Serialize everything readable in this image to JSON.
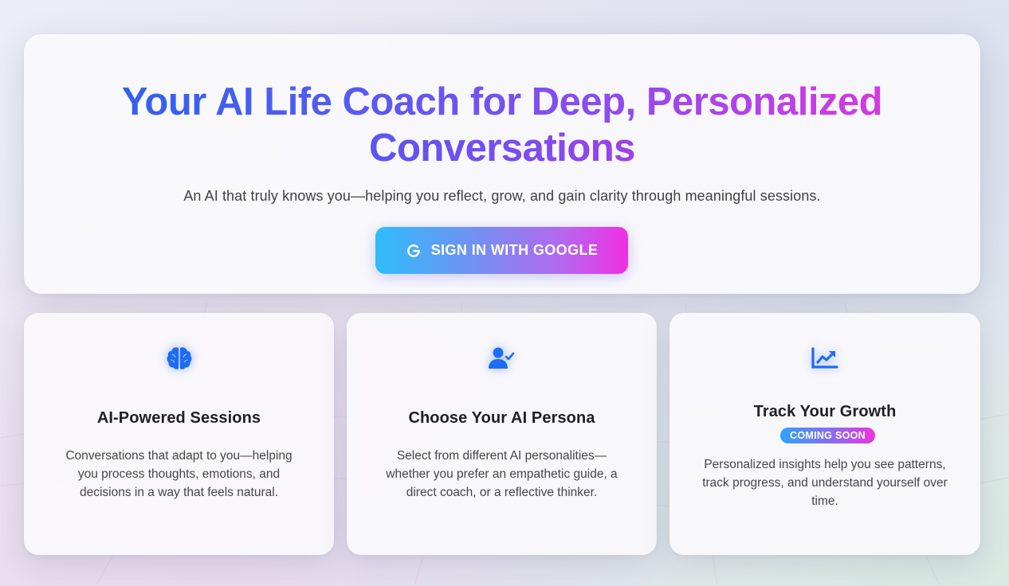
{
  "hero": {
    "title_line1": "Your AI Life Coach for Deep, Personalized",
    "title_line2": "Conversations",
    "subtitle": "An AI that truly knows you—helping you reflect, grow, and gain clarity through meaningful sessions.",
    "signin_label": "SIGN IN WITH GOOGLE",
    "signin_icon": "google-icon"
  },
  "features": [
    {
      "icon": "brain-icon",
      "title": "AI-Powered Sessions",
      "description": "Conversations that adapt to you—helping you process thoughts, emotions, and decisions in a way that feels natural."
    },
    {
      "icon": "user-check-icon",
      "title": "Choose Your AI Persona",
      "description": "Select from different AI personalities—whether you prefer an empathetic guide, a direct coach, or a reflective thinker."
    },
    {
      "icon": "chart-line-icon",
      "title": "Track Your Growth",
      "badge": "COMING SOON",
      "description": "Personalized insights help you see patterns, track progress, and understand yourself over time."
    }
  ],
  "colors": {
    "accent_blue": "#2563eb",
    "accent_purple": "#8a4cf0",
    "accent_pink": "#e535d8",
    "icon_blue": "#1d6cf5"
  }
}
